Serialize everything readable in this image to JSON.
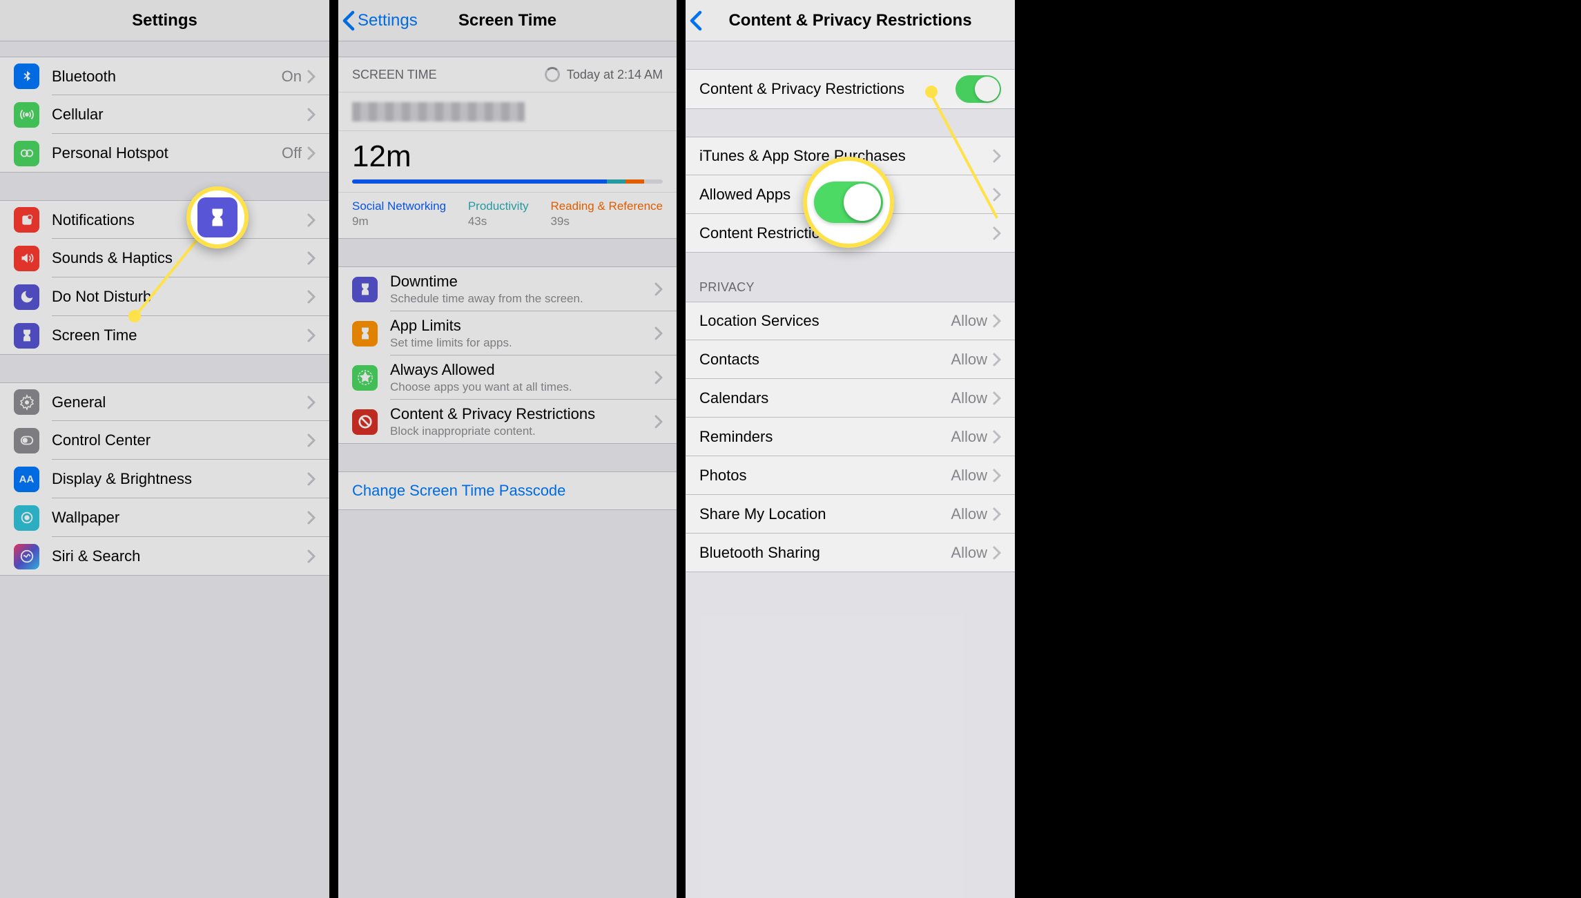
{
  "screen1": {
    "title": "Settings",
    "group1": [
      {
        "icon": "bluetooth-icon",
        "bg": "bg-blue",
        "label": "Bluetooth",
        "value": "On"
      },
      {
        "icon": "cellular-icon",
        "bg": "bg-green",
        "label": "Cellular",
        "value": ""
      },
      {
        "icon": "hotspot-icon",
        "bg": "bg-green",
        "label": "Personal Hotspot",
        "value": "Off"
      }
    ],
    "group2": [
      {
        "icon": "notifications-icon",
        "bg": "bg-red",
        "label": "Notifications"
      },
      {
        "icon": "sounds-icon",
        "bg": "bg-red",
        "label": "Sounds & Haptics"
      },
      {
        "icon": "dnd-icon",
        "bg": "bg-purple",
        "label": "Do Not Disturb"
      },
      {
        "icon": "screentime-icon",
        "bg": "bg-purple",
        "label": "Screen Time"
      }
    ],
    "group3": [
      {
        "icon": "general-icon",
        "bg": "bg-gray",
        "label": "General"
      },
      {
        "icon": "controlcenter-icon",
        "bg": "bg-gray",
        "label": "Control Center"
      },
      {
        "icon": "display-icon",
        "bg": "bg-blue",
        "label": "Display & Brightness"
      },
      {
        "icon": "wallpaper-icon",
        "bg": "bg-cyan",
        "label": "Wallpaper"
      },
      {
        "icon": "siri-icon",
        "bg": "bg-grad",
        "label": "Siri & Search"
      }
    ]
  },
  "screen2": {
    "back": "Settings",
    "title": "Screen Time",
    "section_label": "SCREEN TIME",
    "timestamp": "Today at 2:14 AM",
    "total": "12m",
    "categories": [
      {
        "name": "Social Networking",
        "duration": "9m"
      },
      {
        "name": "Productivity",
        "duration": "43s"
      },
      {
        "name": "Reading & Reference",
        "duration": "39s"
      }
    ],
    "options": [
      {
        "icon": "downtime-icon",
        "bg": "bg-purple",
        "label": "Downtime",
        "sub": "Schedule time away from the screen."
      },
      {
        "icon": "applimits-icon",
        "bg": "bg-orange",
        "label": "App Limits",
        "sub": "Set time limits for apps."
      },
      {
        "icon": "always-icon",
        "bg": "bg-green",
        "label": "Always Allowed",
        "sub": "Choose apps you want at all times."
      },
      {
        "icon": "restrictions-icon",
        "bg": "bg-darkred",
        "label": "Content & Privacy Restrictions",
        "sub": "Block inappropriate content."
      }
    ],
    "change_passcode": "Change Screen Time Passcode"
  },
  "screen3": {
    "title": "Content & Privacy Restrictions",
    "toggle_label": "Content & Privacy Restrictions",
    "group1": [
      {
        "label": "iTunes & App Store Purchases"
      },
      {
        "label": "Allowed Apps"
      },
      {
        "label": "Content Restrictions"
      }
    ],
    "privacy_header": "PRIVACY",
    "privacy_items": [
      {
        "label": "Location Services",
        "value": "Allow"
      },
      {
        "label": "Contacts",
        "value": "Allow"
      },
      {
        "label": "Calendars",
        "value": "Allow"
      },
      {
        "label": "Reminders",
        "value": "Allow"
      },
      {
        "label": "Photos",
        "value": "Allow"
      },
      {
        "label": "Share My Location",
        "value": "Allow"
      },
      {
        "label": "Bluetooth Sharing",
        "value": "Allow"
      }
    ]
  }
}
